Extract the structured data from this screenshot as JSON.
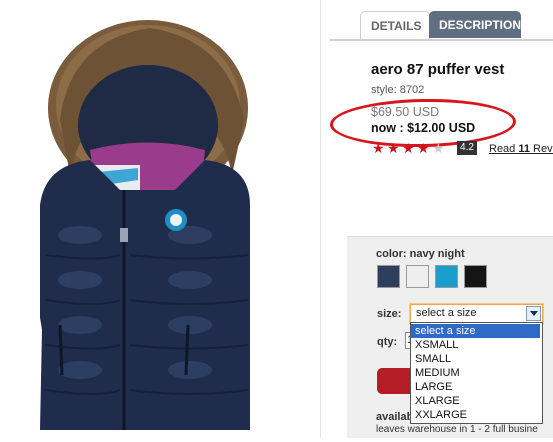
{
  "tabs": [
    {
      "label": "DETAILS"
    },
    {
      "label": "DESCRIPTION"
    }
  ],
  "product": {
    "title": "aero 87 puffer vest",
    "style": "style: 8702",
    "original_price": "$69.50 USD",
    "now_price": "now : $12.00 USD",
    "rating_value": "4.2",
    "rating_stars": 4.2,
    "reviews_prefix": "Read ",
    "reviews_count": "11",
    "reviews_suffix": " Revi"
  },
  "colors": {
    "accent_red": "#d8141d",
    "tab_active": "#5f6f81"
  },
  "options": {
    "color_label": "color:",
    "color_value": "navy night",
    "swatches": [
      {
        "name": "navy",
        "hex": "#2e3e5e"
      },
      {
        "name": "white",
        "hex": "#eeeeee"
      },
      {
        "name": "turquoise",
        "hex": "#1a9ecb"
      },
      {
        "name": "black",
        "hex": "#151515"
      }
    ],
    "size_label": "size:",
    "size_selected": "select a size",
    "size_options": [
      "select a size",
      "XSMALL",
      "SMALL",
      "MEDIUM",
      "LARGE",
      "XLARGE",
      "XXLARGE"
    ],
    "qty_label": "qty:",
    "qty_value": "1",
    "availability_label": "availab",
    "warehouse_text": "leaves warehouse in 1 - 2 full busine"
  },
  "icons": {
    "image": "puffer-vest-product-photo",
    "select_arrow": "chevron-down-icon",
    "star": "star-icon"
  }
}
